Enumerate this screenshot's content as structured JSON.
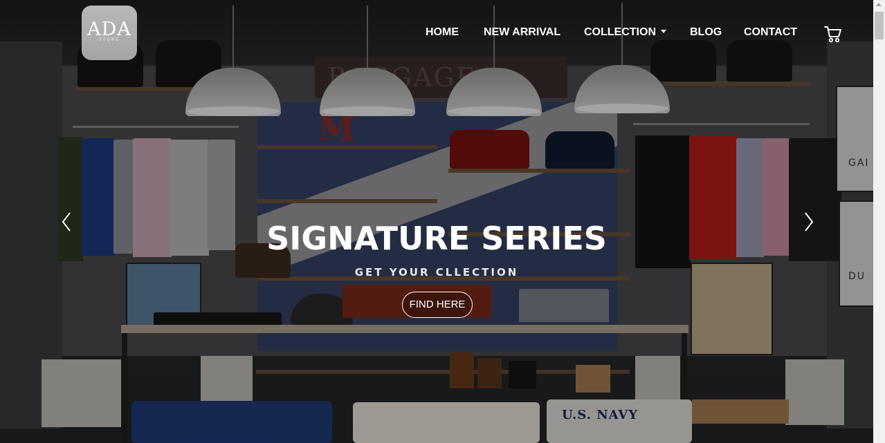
{
  "brand": {
    "logo_text": "ADA",
    "logo_subtext": "STORE"
  },
  "nav": {
    "items": [
      {
        "label": "HOME"
      },
      {
        "label": "NEW ARRIVAL"
      },
      {
        "label": "COLLECTION"
      },
      {
        "label": "BLOG"
      },
      {
        "label": "CONTACT"
      }
    ],
    "cart_icon": "cart-icon"
  },
  "hero": {
    "title": "SIGNATURE SERIES",
    "subtitle": "GET YOUR CLLECTION",
    "button_label": "FIND HERE",
    "prev_icon": "chevron-left-icon",
    "next_icon": "chevron-right-icon"
  },
  "scene": {
    "banner_text": "BAGGAGE",
    "letter": "M",
    "sign_right_top": "GAI",
    "sign_right_bottom": "DU",
    "blanket_text": "U.S. NAVY"
  },
  "colors": {
    "nav_text": "#ffffff",
    "overlay": "#000000",
    "logo_bg": "#b3b3b5"
  }
}
